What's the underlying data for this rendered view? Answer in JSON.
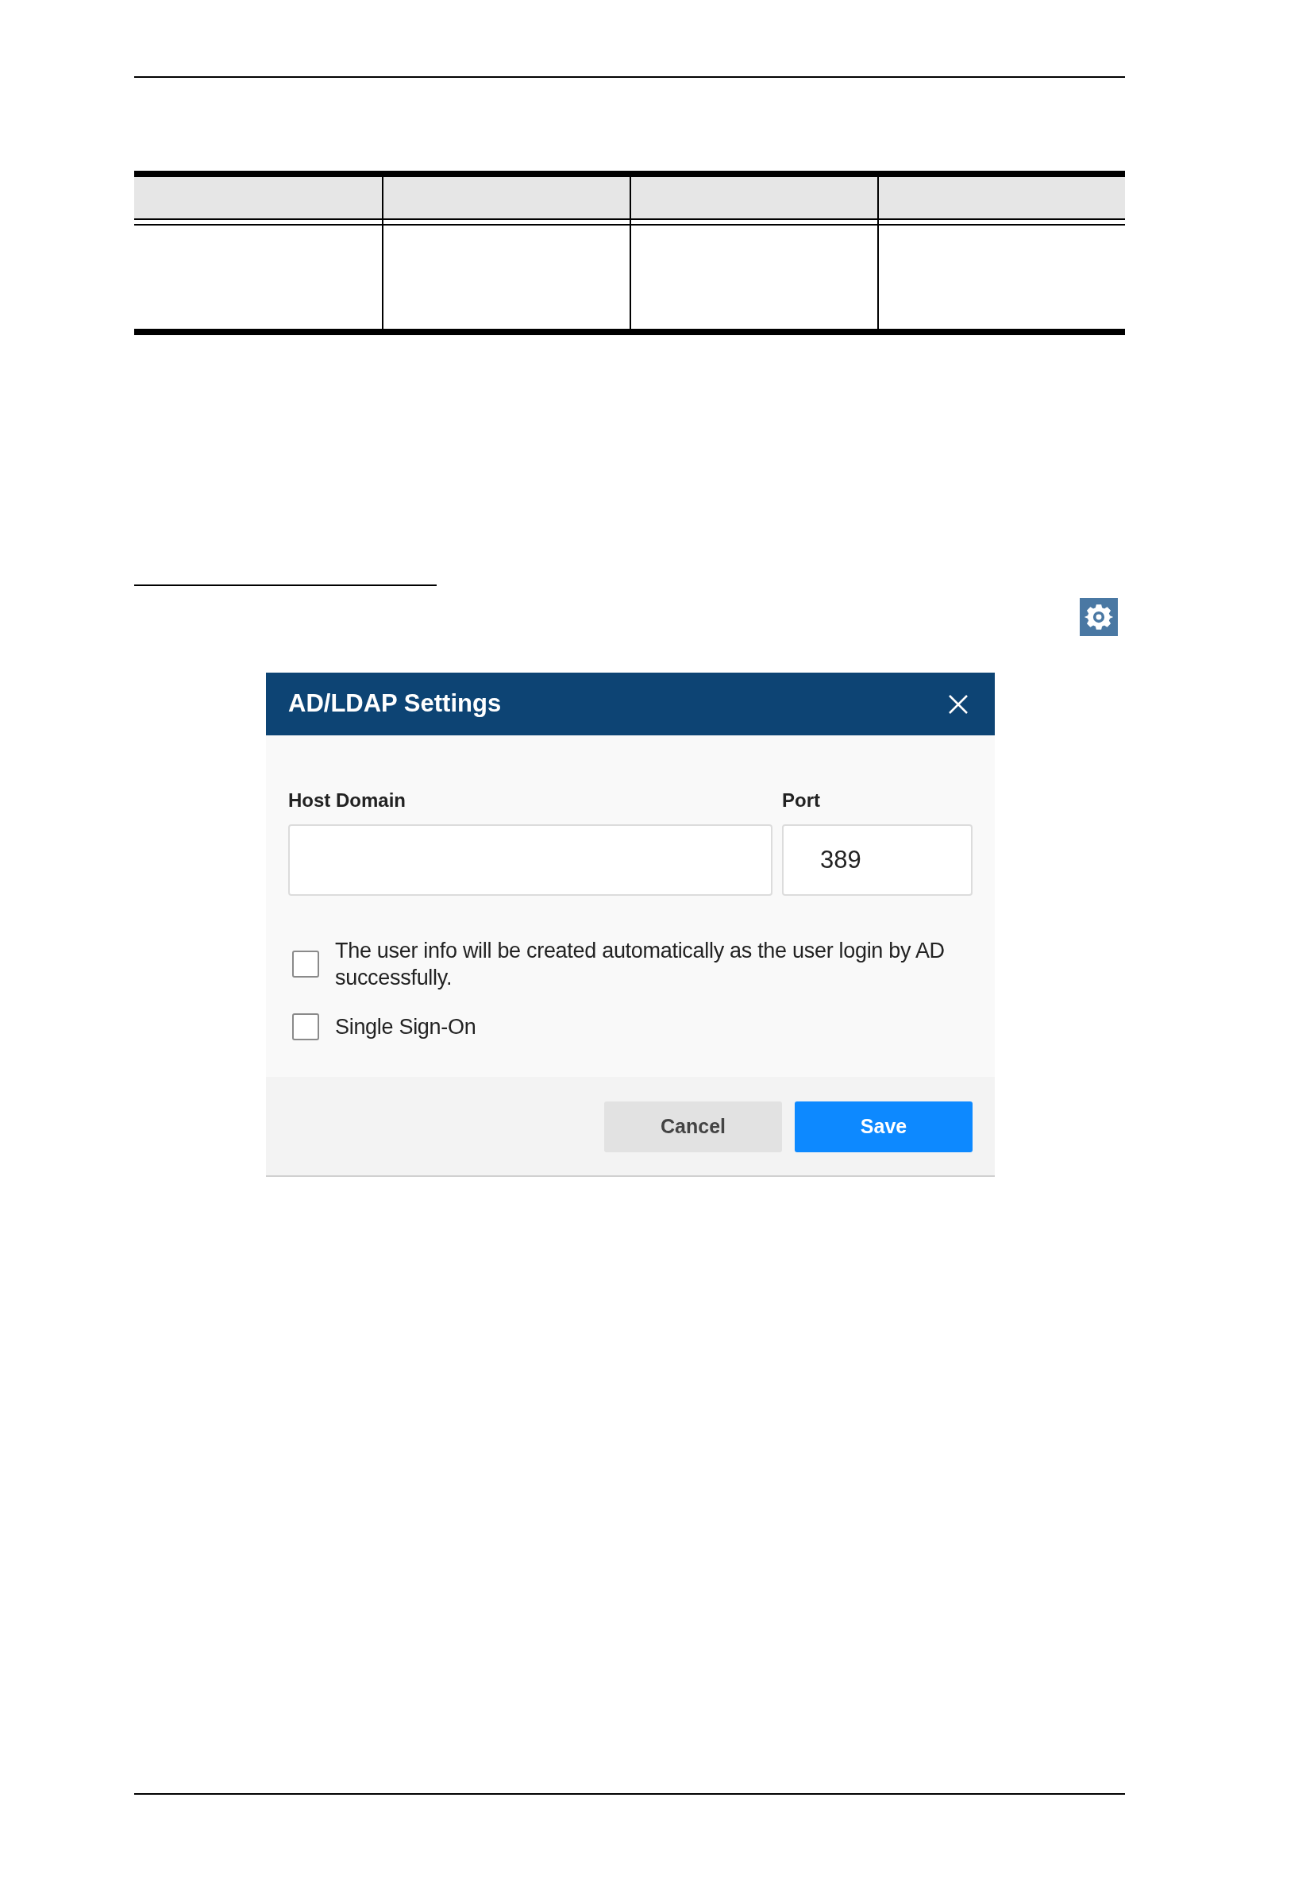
{
  "dialog": {
    "title": "AD/LDAP Settings",
    "fields": [
      {
        "label": "Host Domain"
      },
      {
        "label": "Port",
        "value": "389"
      }
    ],
    "checkboxes": [
      {
        "label": "The user info will be created automatically as the user login by AD successfully.",
        "checked": false
      },
      {
        "label": "Single Sign-On",
        "checked": false
      }
    ],
    "buttons": [
      {
        "label": "Cancel",
        "kind": "secondary"
      },
      {
        "label": "Save",
        "kind": "primary"
      }
    ]
  }
}
